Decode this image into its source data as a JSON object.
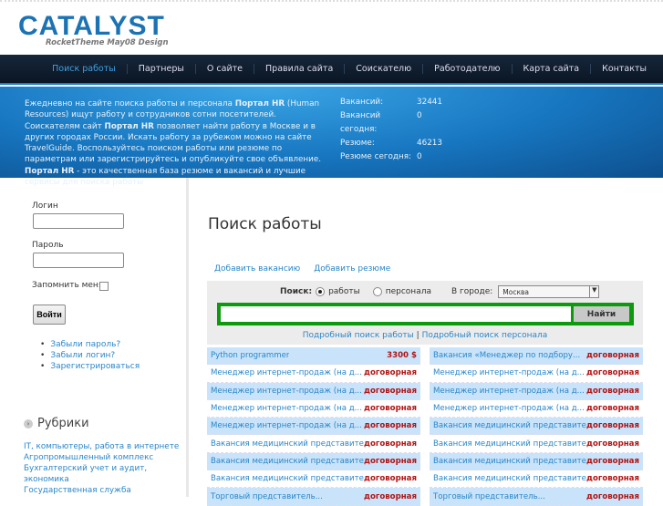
{
  "header": {
    "logo": "CATALYST",
    "tagline": "RocketTheme May08 Design"
  },
  "nav": [
    "Поиск работы",
    "Партнеры",
    "О сайте",
    "Правила сайта",
    "Соискателю",
    "Работодателю",
    "Карта сайта",
    "Контакты"
  ],
  "banner": {
    "intro_parts": [
      "Ежедневно на сайте поиска работы и персонала ",
      "Портал HR",
      " (Human Resources) ищут работу и сотрудников сотни посетителей.  Соискателям сайт ",
      "Портал HR",
      " позволяет найти работу в Москве и в других городах России. Искать работу за рубежом можно на сайте TravelGuide. Воспользуйтесь поиском работы или резюме по параметрам или зарегистрируйтесь и опубликуйте свое объявление.  ",
      "Портал HR",
      " - это качественная база резюме и вакансий и лучшие сервисы для поиска работы"
    ],
    "stats": [
      {
        "label": "Вакансий:",
        "value": "32441"
      },
      {
        "label": "Вакансий сегодня:",
        "value": "0"
      },
      {
        "label": "Резюме:",
        "value": "46213"
      },
      {
        "label": "Резюме сегодня:",
        "value": "0"
      }
    ]
  },
  "login": {
    "login_label": "Логин",
    "password_label": "Пароль",
    "remember_label": "Запомнить меня",
    "submit": "Войти",
    "links": [
      "Забыли пароль?",
      "Забыли логин?",
      "Зарегистрироваться"
    ]
  },
  "rubrics": {
    "title": "Рубрики",
    "items": [
      "IT, компьютеры, работа в интернете",
      "Агропромышленный комплекс",
      "Бухгалтерский учет и аудит,",
      "экономика",
      "Государственная служба"
    ]
  },
  "main": {
    "title": "Поиск работы",
    "actions": [
      "Добавить вакансию",
      "Добавить резюме"
    ],
    "search": {
      "label": "Поиск:",
      "opt_jobs": "работы",
      "opt_staff": "персонала",
      "city_label": "В городе:",
      "city": "Москва",
      "query": "",
      "button": "Найти",
      "adv_jobs": "Подробный поиск работы",
      "adv_sep": "|",
      "adv_staff": "Подробный поиск персонала"
    }
  },
  "jobs_left": [
    [
      "Python programmer",
      "3300 $"
    ],
    [
      "Менеджер интернет-продаж (на д...",
      "договорная"
    ],
    [
      "Менеджер интернет-продаж (на д...",
      "договорная"
    ],
    [
      "Менеджер интернет-продаж (на д...",
      "договорная"
    ],
    [
      "Менеджер интернет-продаж (на д...",
      "договорная"
    ],
    [
      "Вакансия медицинский представитель...",
      "договорная"
    ],
    [
      "Вакансия медицинский представитель...",
      "договорная"
    ],
    [
      "Вакансия медицинский представитель...",
      "договорная"
    ],
    [
      "Торговый представитель...",
      "договорная"
    ]
  ],
  "jobs_right": [
    [
      "Вакансия «Менеджер по подбору...",
      "договорная"
    ],
    [
      "Менеджер интернет-продаж (на д...",
      "договорная"
    ],
    [
      "Менеджер интернет-продаж (на д...",
      "договорная"
    ],
    [
      "Менеджер интернет-продаж (на д...",
      "договорная"
    ],
    [
      "Вакансия медицинский представитель...",
      "договорная"
    ],
    [
      "Вакансия медицинский представитель...",
      "договорная"
    ],
    [
      "Вакансия медицинский представитель...",
      "договорная"
    ],
    [
      "Вакансия медицинский представитель...",
      "договорная"
    ],
    [
      "Торговый представитель...",
      "договорная"
    ]
  ]
}
